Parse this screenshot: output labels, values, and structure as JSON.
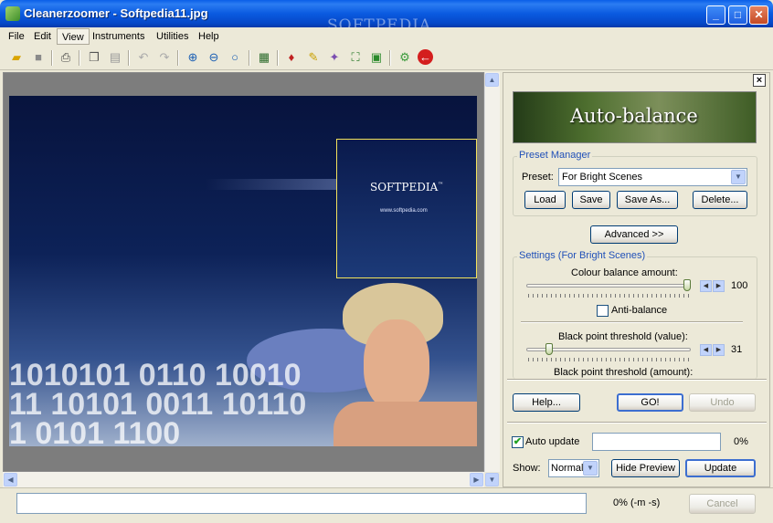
{
  "window": {
    "title": "Cleanerzoomer - Softpedia11.jpg",
    "watermark": "SOFTPEDIA"
  },
  "menu": [
    "File",
    "Edit",
    "View",
    "Instruments",
    "Utilities",
    "Help"
  ],
  "toolbar": {
    "icons": [
      "open-folder-icon",
      "save-icon",
      "print-icon",
      "copy-icon",
      "paste-icon",
      "undo-icon",
      "redo-icon",
      "zoom-in-icon",
      "zoom-out-icon",
      "zoom-icon",
      "calculator-icon",
      "drop-icon",
      "brush-icon",
      "wand-icon",
      "fit-icon",
      "screen-icon",
      "gear-icon",
      "back-icon"
    ]
  },
  "image": {
    "logo": "SOFTPEDIA",
    "logo_tm": "™",
    "url": "www.softpedia.com",
    "binary": "1010101 0110 1001011 10101 0011 101101 0101 1100"
  },
  "panel": {
    "banner": "Auto-balance",
    "preset_manager": {
      "group_label": "Preset Manager",
      "preset_label": "Preset:",
      "preset_value": "For Bright Scenes",
      "load": "Load",
      "save": "Save",
      "save_as": "Save As...",
      "delete": "Delete..."
    },
    "advanced": "Advanced >>",
    "settings": {
      "group_label": "Settings (For Bright Scenes)",
      "colour_balance_label": "Colour balance amount:",
      "colour_balance_value": "100",
      "colour_balance_level": 1.0,
      "anti_balance_label": "Anti-balance",
      "anti_balance_checked": false,
      "black_value_label": "Black point threshold (value):",
      "black_value_value": "31",
      "black_value_level": 0.12,
      "black_amount_label": "Black point threshold (amount):"
    },
    "help": "Help...",
    "go": "GO!",
    "undo": "Undo",
    "auto_update_label": "Auto update",
    "auto_update_checked": true,
    "progress_pct": "0%",
    "show_label": "Show:",
    "show_value": "Normal",
    "hide_preview": "Hide Preview",
    "update": "Update"
  },
  "statusbar": {
    "progress_text": "0% (-m -s)",
    "cancel": "Cancel"
  }
}
